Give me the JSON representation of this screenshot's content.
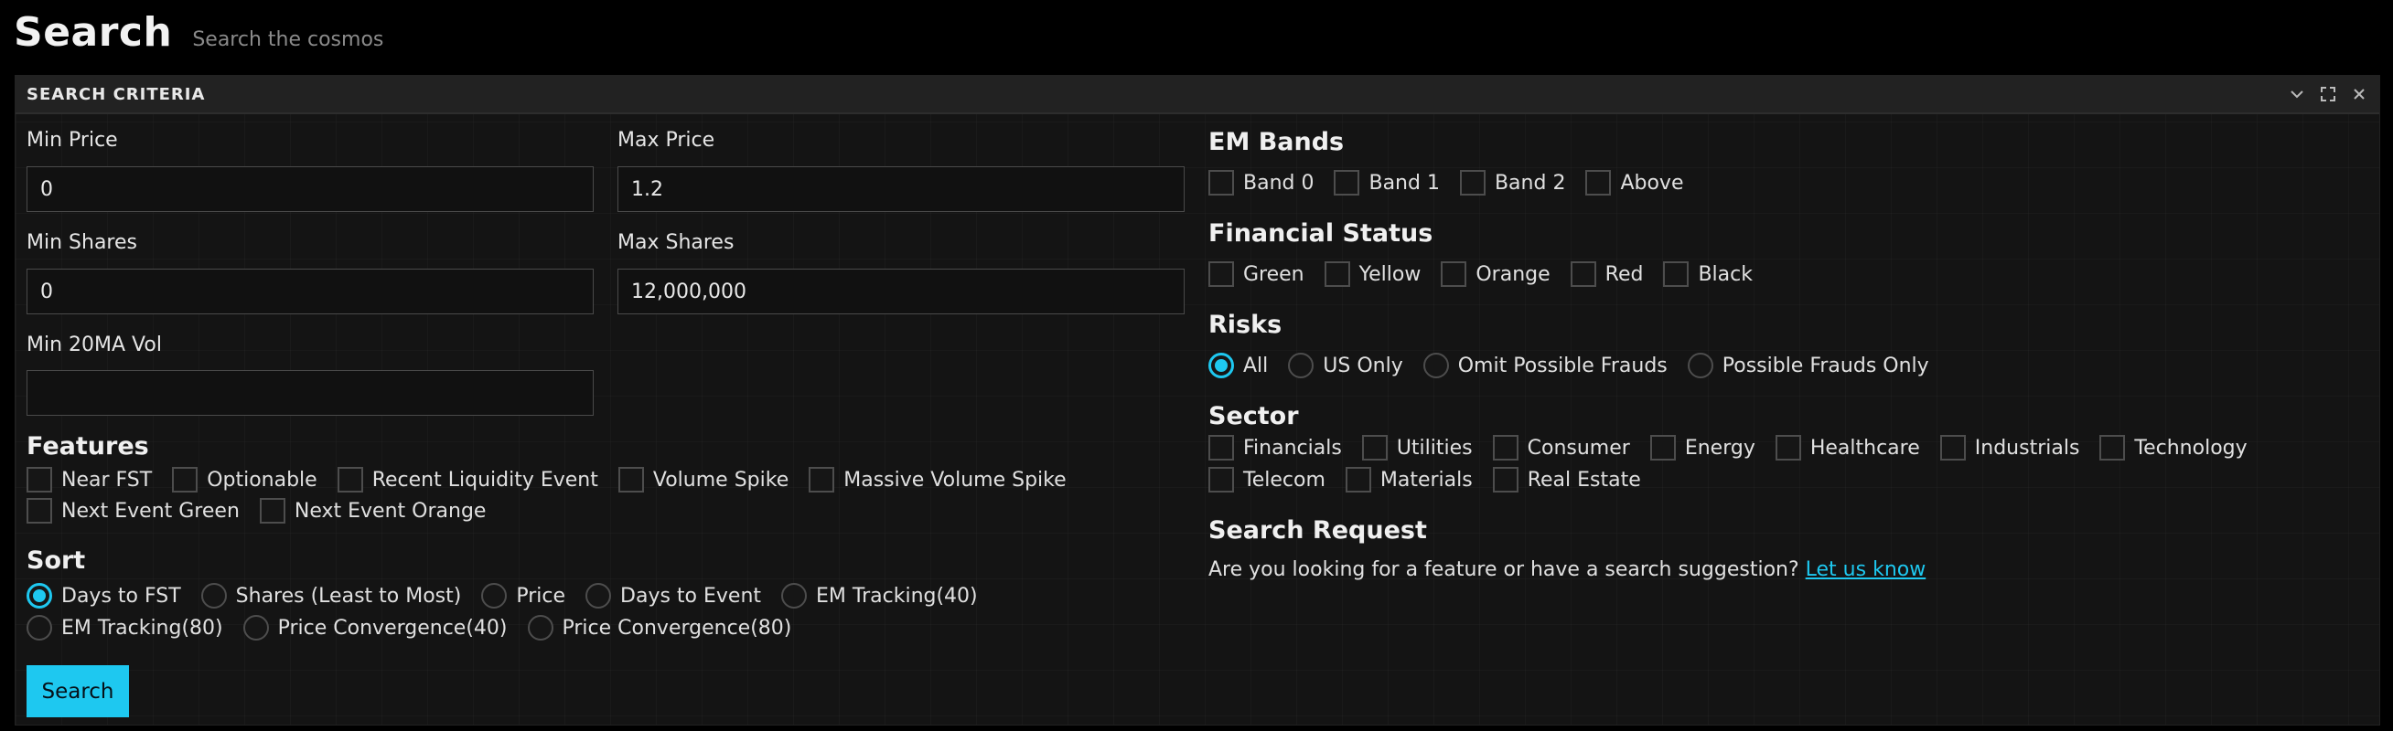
{
  "header": {
    "title": "Search",
    "subtitle": "Search the cosmos"
  },
  "panel": {
    "title": "SEARCH CRITERIA"
  },
  "fields": {
    "min_price": {
      "label": "Min Price",
      "value": "0"
    },
    "max_price": {
      "label": "Max Price",
      "value": "1.2"
    },
    "min_shares": {
      "label": "Min Shares",
      "value": "0"
    },
    "max_shares": {
      "label": "Max Shares",
      "value": "12,000,000"
    },
    "min_20ma_vol": {
      "label": "Min 20MA Vol",
      "value": ""
    }
  },
  "features": {
    "title": "Features",
    "items": [
      "Near FST",
      "Optionable",
      "Recent Liquidity Event",
      "Volume Spike",
      "Massive Volume Spike",
      "Next Event Green",
      "Next Event Orange"
    ]
  },
  "sort": {
    "title": "Sort",
    "selected": "Days to FST",
    "options": [
      "Days to FST",
      "Shares (Least to Most)",
      "Price",
      "Days to Event",
      "EM Tracking(40)",
      "EM Tracking(80)",
      "Price Convergence(40)",
      "Price Convergence(80)"
    ]
  },
  "search_button": {
    "label": "Search"
  },
  "em_bands": {
    "title": "EM Bands",
    "items": [
      "Band 0",
      "Band 1",
      "Band 2",
      "Above"
    ]
  },
  "financial_status": {
    "title": "Financial Status",
    "items": [
      "Green",
      "Yellow",
      "Orange",
      "Red",
      "Black"
    ]
  },
  "risks": {
    "title": "Risks",
    "selected": "All",
    "options": [
      "All",
      "US Only",
      "Omit Possible Frauds",
      "Possible Frauds Only"
    ]
  },
  "sector": {
    "title": "Sector",
    "items": [
      "Financials",
      "Utilities",
      "Consumer",
      "Energy",
      "Healthcare",
      "Industrials",
      "Technology",
      "Telecom",
      "Materials",
      "Real Estate"
    ]
  },
  "search_request": {
    "title": "Search Request",
    "text": "Are you looking for a feature or have a search suggestion?",
    "link": "Let us know"
  },
  "colors": {
    "accent": "#1ec8f0",
    "background": "#000000",
    "panel": "#141414"
  }
}
